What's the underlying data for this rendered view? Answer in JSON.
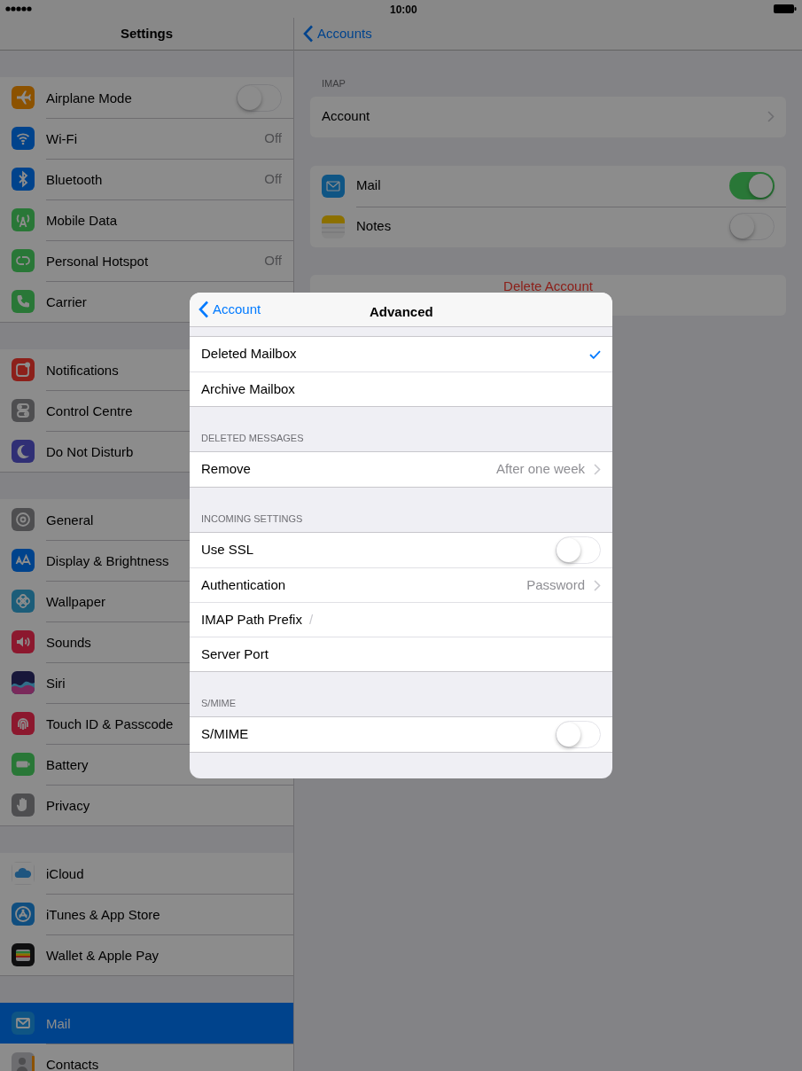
{
  "status_bar": {
    "time": "10:00"
  },
  "sidebar": {
    "title": "Settings",
    "groups": [
      [
        {
          "label": "Airplane Mode",
          "kind": "toggle",
          "on": false,
          "selected": false
        },
        {
          "label": "Wi-Fi",
          "kind": "value",
          "value": "Off",
          "selected": false
        },
        {
          "label": "Bluetooth",
          "kind": "value",
          "value": "Off",
          "selected": false
        },
        {
          "label": "Mobile Data",
          "kind": "plain",
          "selected": false
        },
        {
          "label": "Personal Hotspot",
          "kind": "value",
          "value": "Off",
          "selected": false
        },
        {
          "label": "Carrier",
          "kind": "plain",
          "selected": false
        }
      ],
      [
        {
          "label": "Notifications",
          "kind": "plain",
          "selected": false
        },
        {
          "label": "Control Centre",
          "kind": "plain",
          "selected": false
        },
        {
          "label": "Do Not Disturb",
          "kind": "plain",
          "selected": false
        }
      ],
      [
        {
          "label": "General",
          "kind": "plain",
          "selected": false
        },
        {
          "label": "Display & Brightness",
          "kind": "plain",
          "selected": false
        },
        {
          "label": "Wallpaper",
          "kind": "plain",
          "selected": false
        },
        {
          "label": "Sounds",
          "kind": "plain",
          "selected": false
        },
        {
          "label": "Siri",
          "kind": "plain",
          "selected": false
        },
        {
          "label": "Touch ID & Passcode",
          "kind": "plain",
          "selected": false
        },
        {
          "label": "Battery",
          "kind": "plain",
          "selected": false
        },
        {
          "label": "Privacy",
          "kind": "plain",
          "selected": false
        }
      ],
      [
        {
          "label": "iCloud",
          "kind": "plain",
          "selected": false
        },
        {
          "label": "iTunes & App Store",
          "kind": "plain",
          "selected": false
        },
        {
          "label": "Wallet & Apple Pay",
          "kind": "plain",
          "selected": false
        }
      ],
      [
        {
          "label": "Mail",
          "kind": "plain",
          "selected": true
        },
        {
          "label": "Contacts",
          "kind": "plain",
          "selected": false
        }
      ]
    ]
  },
  "detail": {
    "back": "Accounts",
    "section_header": "IMAP",
    "account_row": "Account",
    "apps": [
      {
        "label": "Mail",
        "on": true
      },
      {
        "label": "Notes",
        "on": false
      }
    ],
    "delete_button": "Delete Account"
  },
  "modal": {
    "back": "Account",
    "title": "Advanced",
    "sections": [
      {
        "rows": [
          {
            "kind": "option",
            "label": "Deleted Mailbox",
            "checked": true
          },
          {
            "kind": "option",
            "label": "Archive Mailbox",
            "checked": false
          }
        ]
      },
      {
        "header": "DELETED MESSAGES",
        "rows": [
          {
            "kind": "detail",
            "label": "Remove",
            "value": "After one week"
          }
        ]
      },
      {
        "header": "INCOMING SETTINGS",
        "rows": [
          {
            "kind": "toggle",
            "label": "Use SSL",
            "on": false
          },
          {
            "kind": "detail",
            "label": "Authentication",
            "value": "Password"
          },
          {
            "kind": "field",
            "label": "IMAP Path Prefix",
            "placeholder": "/"
          },
          {
            "kind": "field",
            "label": "Server Port"
          }
        ]
      },
      {
        "header": "S/MIME",
        "rows": [
          {
            "kind": "toggle",
            "label": "S/MIME",
            "on": false
          }
        ]
      }
    ]
  }
}
